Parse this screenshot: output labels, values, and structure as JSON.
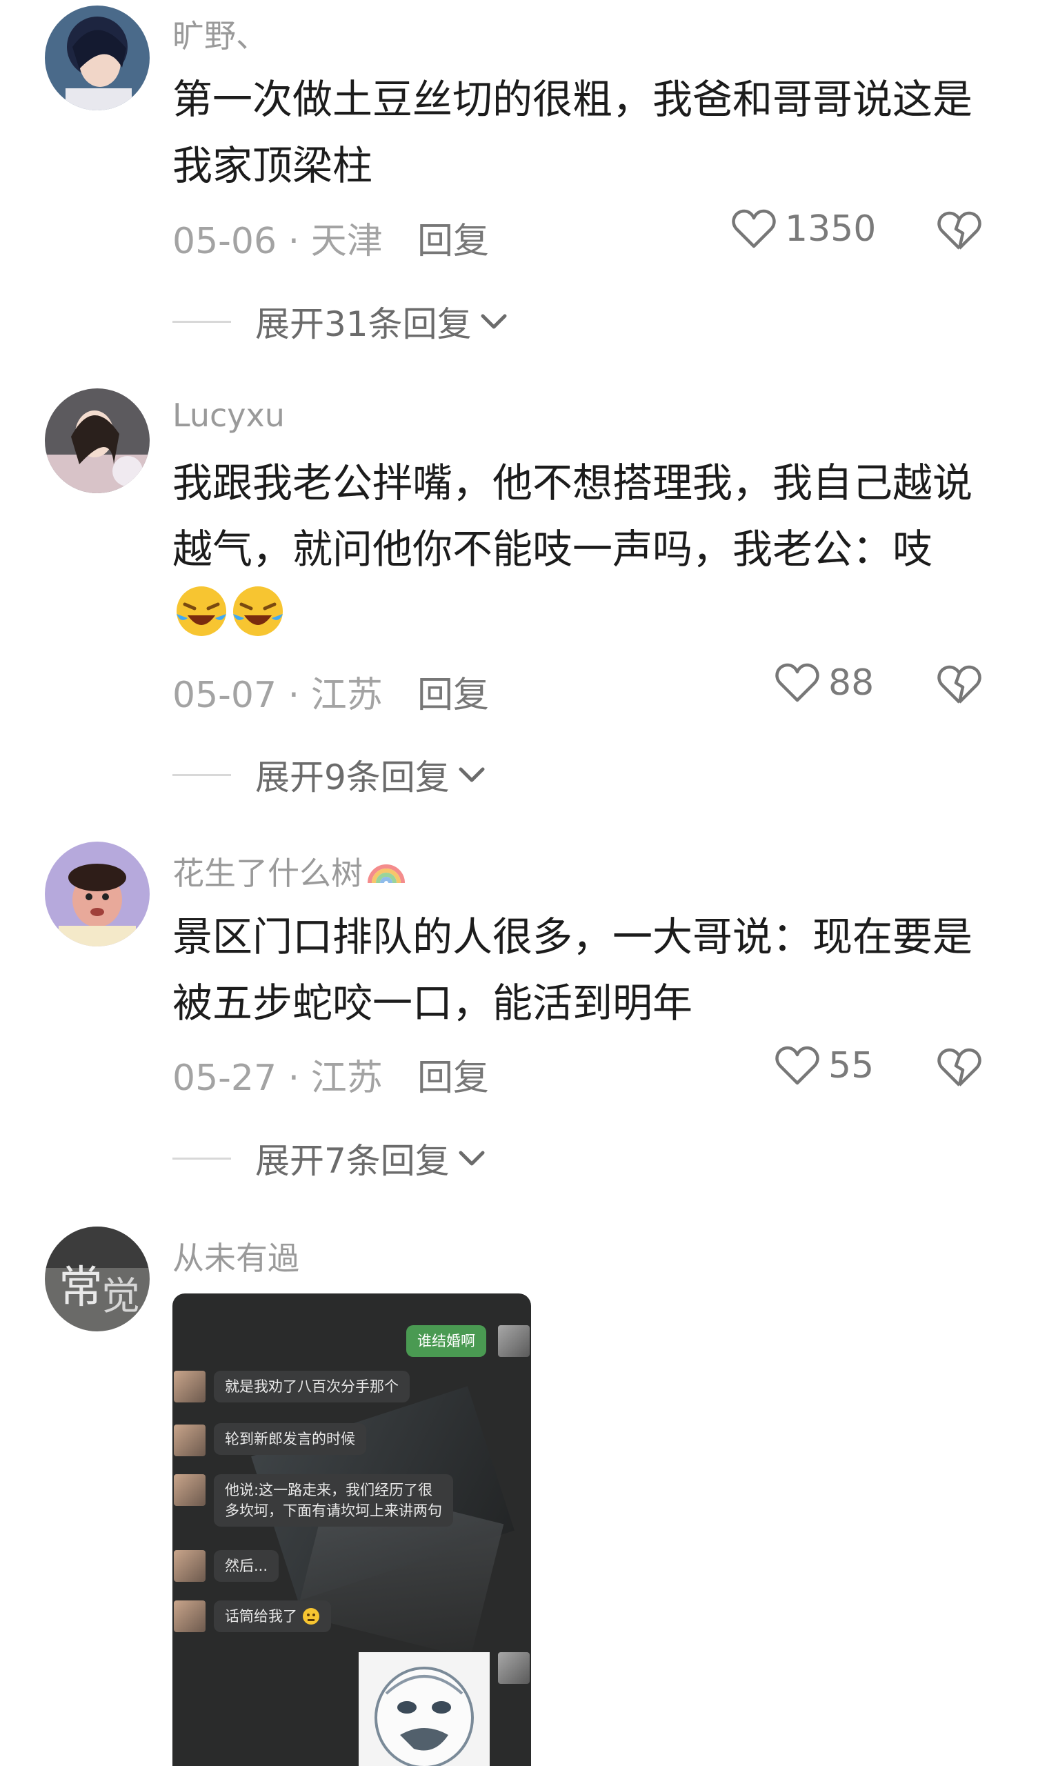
{
  "comments": [
    {
      "username": "旷野、",
      "text": "第一次做土豆丝切的很粗，我爸和哥哥说这是我家顶梁柱",
      "date_location": "05-06 · 天津",
      "reply_label": "回复",
      "likes": "1350",
      "expand_label": "展开31条回复"
    },
    {
      "username": "Lucyxu",
      "text": "我跟我老公拌嘴，他不想搭理我，我自己越说越气，就问他你不能吱一声吗，我老公：吱",
      "date_location": "05-07 · 江苏",
      "reply_label": "回复",
      "likes": "88",
      "expand_label": "展开9条回复"
    },
    {
      "username": "花生了什么树",
      "text": "景区门口排队的人很多，一大哥说：现在要是被五步蛇咬一口，能活到明年",
      "date_location": "05-27 · 江苏",
      "reply_label": "回复",
      "likes": "55",
      "expand_label": "展开7条回复"
    },
    {
      "username": "从未有過",
      "chat_image": {
        "messages": [
          {
            "text": "谁结婚啊",
            "side": "right"
          },
          {
            "text": "就是我劝了八百次分手那个",
            "side": "left"
          },
          {
            "text": "轮到新郎发言的时候",
            "side": "left"
          },
          {
            "text": "他说:这一路走来，我们经历了很",
            "side": "left"
          },
          {
            "text": "多坎坷，下面有请坎坷上来讲两句",
            "side": "left"
          },
          {
            "text": "然后...",
            "side": "left"
          },
          {
            "text": "话筒给我了",
            "side": "left"
          }
        ]
      }
    }
  ],
  "icons": {
    "like": "heart-outline-icon",
    "dislike": "broken-heart-icon",
    "expand": "chevron-down-icon"
  },
  "colors": {
    "meta_gray": "#a3a3a3",
    "chat_green": "#4a9a52"
  }
}
